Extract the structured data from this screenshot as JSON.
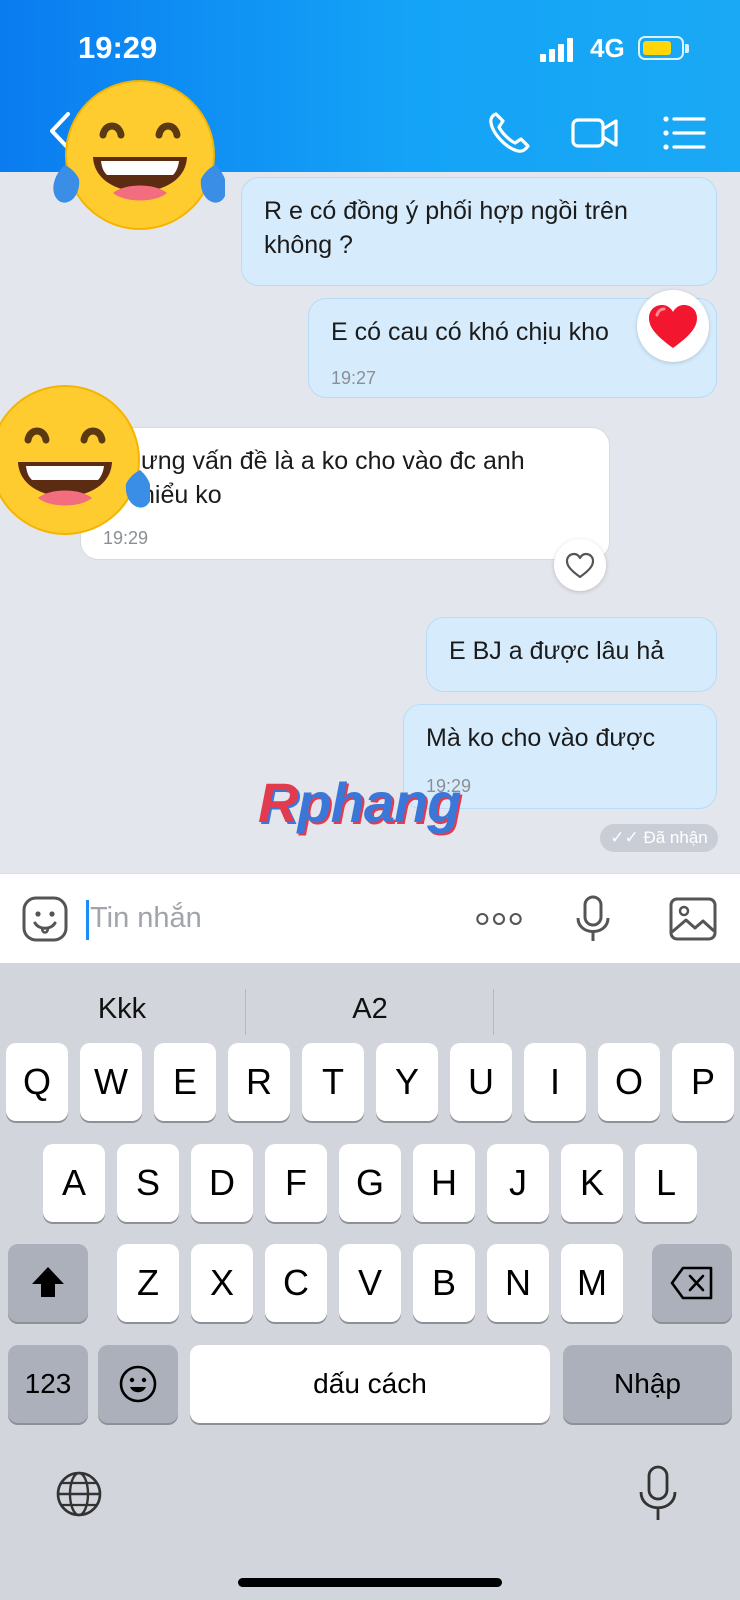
{
  "status_bar": {
    "time": "19:29",
    "network": "4G"
  },
  "header": {
    "back_icon": "chevron-left-icon",
    "call_icon": "phone-icon",
    "video_icon": "video-camera-icon",
    "menu_icon": "list-menu-icon",
    "avatar_sticker": "laughing-tears-emoji"
  },
  "messages": [
    {
      "direction": "out",
      "text": "R e có đồng ý phối hợp ngồi trên\nkhông ?",
      "time": ""
    },
    {
      "direction": "out",
      "text": "E có cau có khó chịu kho",
      "time": "19:27",
      "reaction": "heart"
    },
    {
      "direction": "in",
      "text": "ưng vấn đề là a ko cho vào đc anh\nhiểu ko",
      "time": "19:29",
      "reaction": "heart-outline"
    },
    {
      "direction": "out",
      "text": "E BJ a được lâu hả",
      "time": ""
    },
    {
      "direction": "out",
      "text": "Mà ko cho vào được",
      "time": "19:29"
    }
  ],
  "received_status": "Đã nhận",
  "watermark": {
    "first": "R",
    "rest": "phang"
  },
  "input": {
    "placeholder": "Tin nhắn",
    "sticker_icon": "smiley-sticker-icon",
    "more_icon": "more-dots-icon",
    "mic_icon": "microphone-icon",
    "image_icon": "image-icon"
  },
  "keyboard": {
    "suggestions": [
      "Kkk",
      "A2",
      ""
    ],
    "row1": [
      "Q",
      "W",
      "E",
      "R",
      "T",
      "Y",
      "U",
      "I",
      "O",
      "P"
    ],
    "row2": [
      "A",
      "S",
      "D",
      "F",
      "G",
      "H",
      "J",
      "K",
      "L"
    ],
    "row3": [
      "Z",
      "X",
      "C",
      "V",
      "B",
      "N",
      "M"
    ],
    "numbers_key": "123",
    "space_key": "dấu cách",
    "return_key": "Nhập",
    "shift_icon": "shift-arrow-icon",
    "delete_icon": "backspace-icon",
    "emoji_icon": "emoji-key-icon",
    "globe_icon": "globe-icon",
    "dictation_icon": "microphone-icon"
  },
  "colors": {
    "header_blue": "#0a7cf0",
    "outgoing_bubble": "#d6ecfc",
    "incoming_bubble": "#ffffff",
    "accent": "#1c8df5"
  }
}
